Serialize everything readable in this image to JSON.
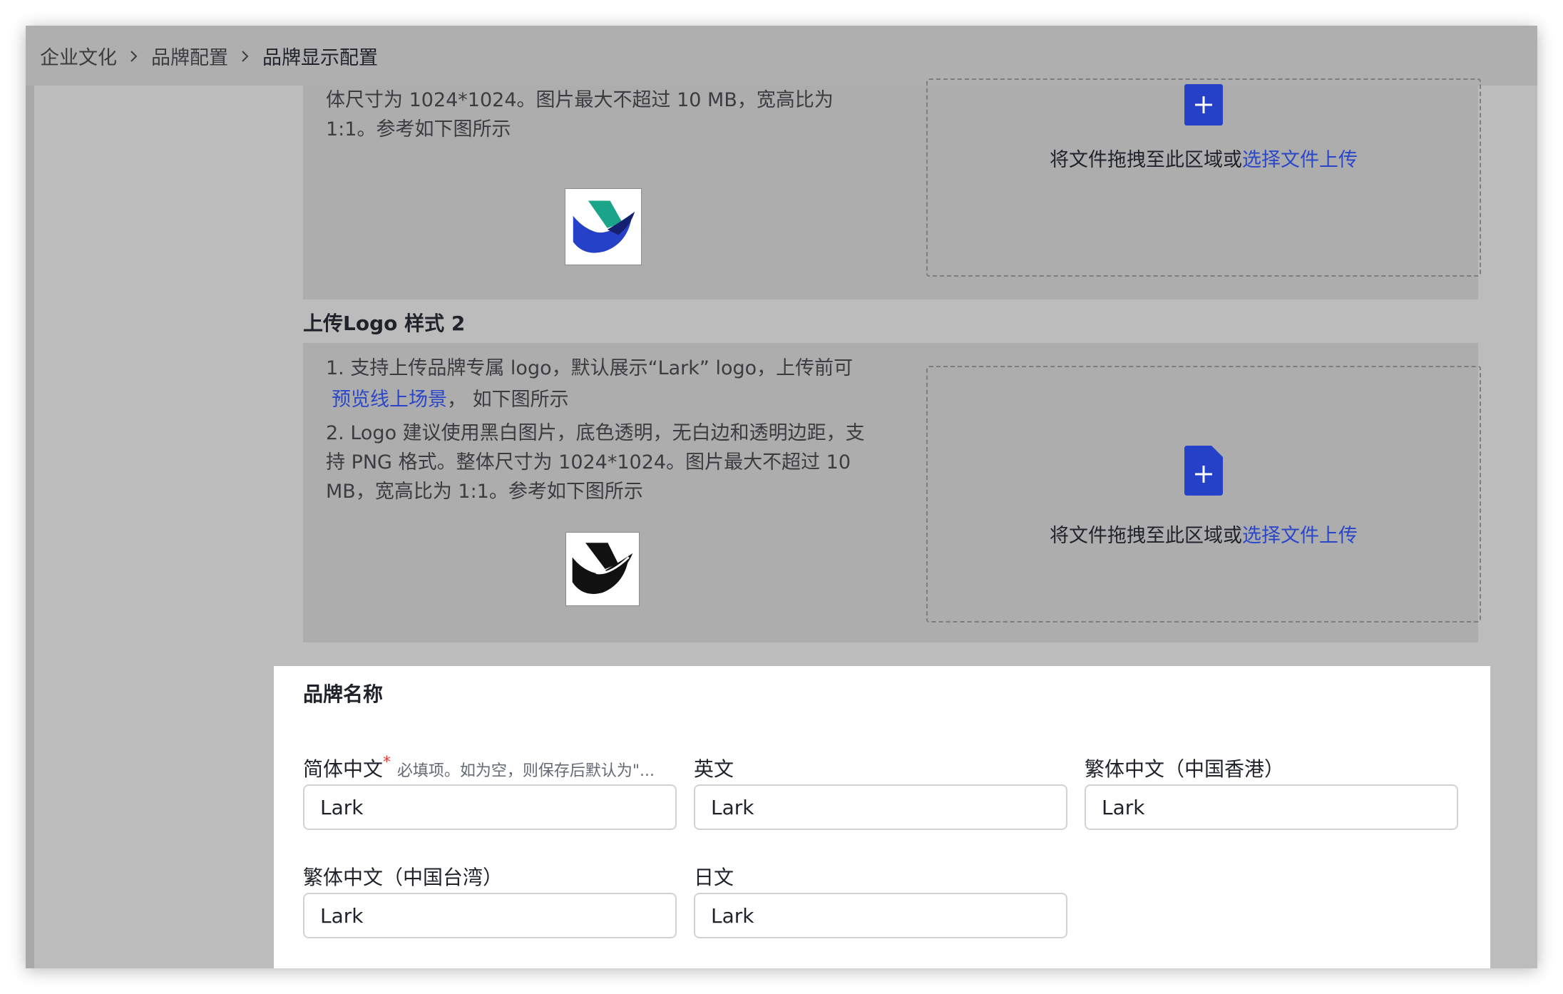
{
  "breadcrumb": [
    "企业文化",
    "品牌配置",
    "品牌显示配置"
  ],
  "logo_style_1": {
    "desc_lines": [
      "体尺寸为 1024*1024。图片最大不超过 10 MB，宽高比为",
      "1:1。参考如下图所示"
    ],
    "upload": {
      "text": "将文件拖拽至此区域或",
      "link": "选择文件上传"
    }
  },
  "logo_style_2": {
    "title": "上传Logo 样式 2",
    "desc_1": "1. 支持上传品牌专属 logo，默认展示“Lark” logo，上传前可",
    "desc_1_link": "预览线上场景",
    "desc_1_tail": "， 如下图所示",
    "desc_2_lines": [
      "2. Logo 建议使用黑白图片，底色透明，无白边和透明边距，支",
      "持 PNG 格式。整体尺寸为 1024*1024。图片最大不超过 10",
      "MB，宽高比为 1:1。参考如下图所示"
    ],
    "upload": {
      "text": "将文件拖拽至此区域或",
      "link": "选择文件上传"
    }
  },
  "brand_name": {
    "title": "品牌名称",
    "fields": {
      "zh_cn": {
        "label": "简体中文",
        "required": "*",
        "hint": "必填项。如为空，则保存后默认为\"...",
        "value": "Lark"
      },
      "en": {
        "label": "英文",
        "value": "Lark"
      },
      "zh_hk": {
        "label": "繁体中文（中国香港）",
        "value": "Lark"
      },
      "zh_tw": {
        "label": "繁体中文（中国台湾）",
        "value": "Lark"
      },
      "ja": {
        "label": "日文",
        "value": "Lark"
      }
    }
  },
  "colors": {
    "accent": "#2a47c9",
    "logo_teal": "#1aa58a",
    "logo_blue": "#2441c7",
    "logo_navy": "#15206e"
  }
}
